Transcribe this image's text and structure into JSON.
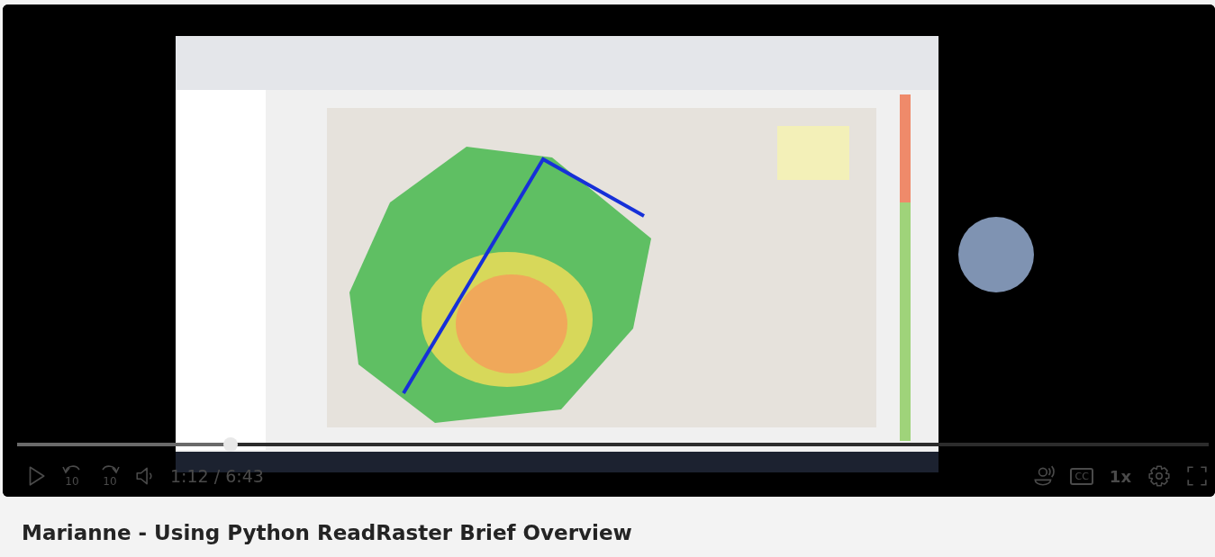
{
  "video": {
    "kind": "picture",
    "progress": {
      "level": 0.179
    },
    "skip_back": "10",
    "skip_forward": "10",
    "time": "1:12 / 6:43",
    "captions": "CC",
    "speed": "1x"
  },
  "title": "Marianne - Using Python ReadRaster Brief Overview"
}
